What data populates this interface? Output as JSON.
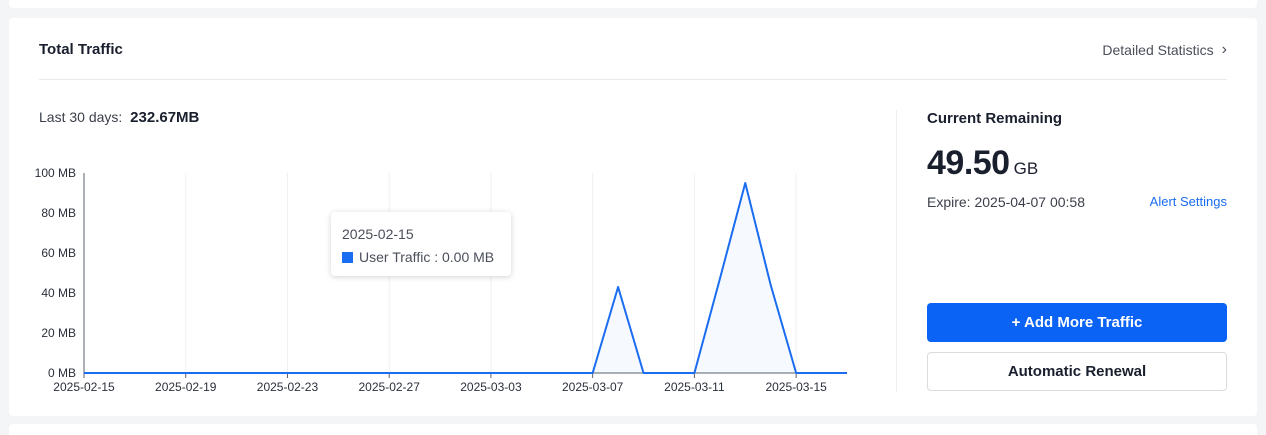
{
  "card": {
    "title": "Total Traffic",
    "detail_link": "Detailed Statistics",
    "stat_label": "Last 30 days:",
    "stat_value": "232.67MB"
  },
  "remaining": {
    "title": "Current Remaining",
    "value": "49.50",
    "unit": "GB",
    "expire_label": "Expire:",
    "expire_value": "2025-04-07 00:58",
    "alert_link": "Alert Settings",
    "add_button": "+ Add More Traffic",
    "renew_button": "Automatic Renewal"
  },
  "tooltip": {
    "date": "2025-02-15",
    "series": "User Traffic",
    "value": "0.00 MB"
  },
  "colors": {
    "accent": "#0b63f6",
    "line": "#1a6cf0"
  },
  "chart_data": {
    "type": "area",
    "y_ticks": [
      "0 MB",
      "20 MB",
      "40 MB",
      "60 MB",
      "80 MB",
      "100 MB"
    ],
    "ylim": [
      0,
      100
    ],
    "x_ticks": [
      "2025-02-15",
      "2025-02-19",
      "2025-02-23",
      "2025-02-27",
      "2025-03-03",
      "2025-03-07",
      "2025-03-11",
      "2025-03-15"
    ],
    "series": [
      {
        "name": "User Traffic",
        "points": [
          {
            "x": "2025-02-15",
            "y": 0
          },
          {
            "x": "2025-03-07",
            "y": 0
          },
          {
            "x": "2025-03-08",
            "y": 43
          },
          {
            "x": "2025-03-09",
            "y": 0
          },
          {
            "x": "2025-03-11",
            "y": 0
          },
          {
            "x": "2025-03-12",
            "y": 47
          },
          {
            "x": "2025-03-13",
            "y": 95
          },
          {
            "x": "2025-03-14",
            "y": 44
          },
          {
            "x": "2025-03-15",
            "y": 0
          },
          {
            "x": "2025-03-17",
            "y": 0
          }
        ]
      }
    ],
    "grid": "vertical"
  }
}
